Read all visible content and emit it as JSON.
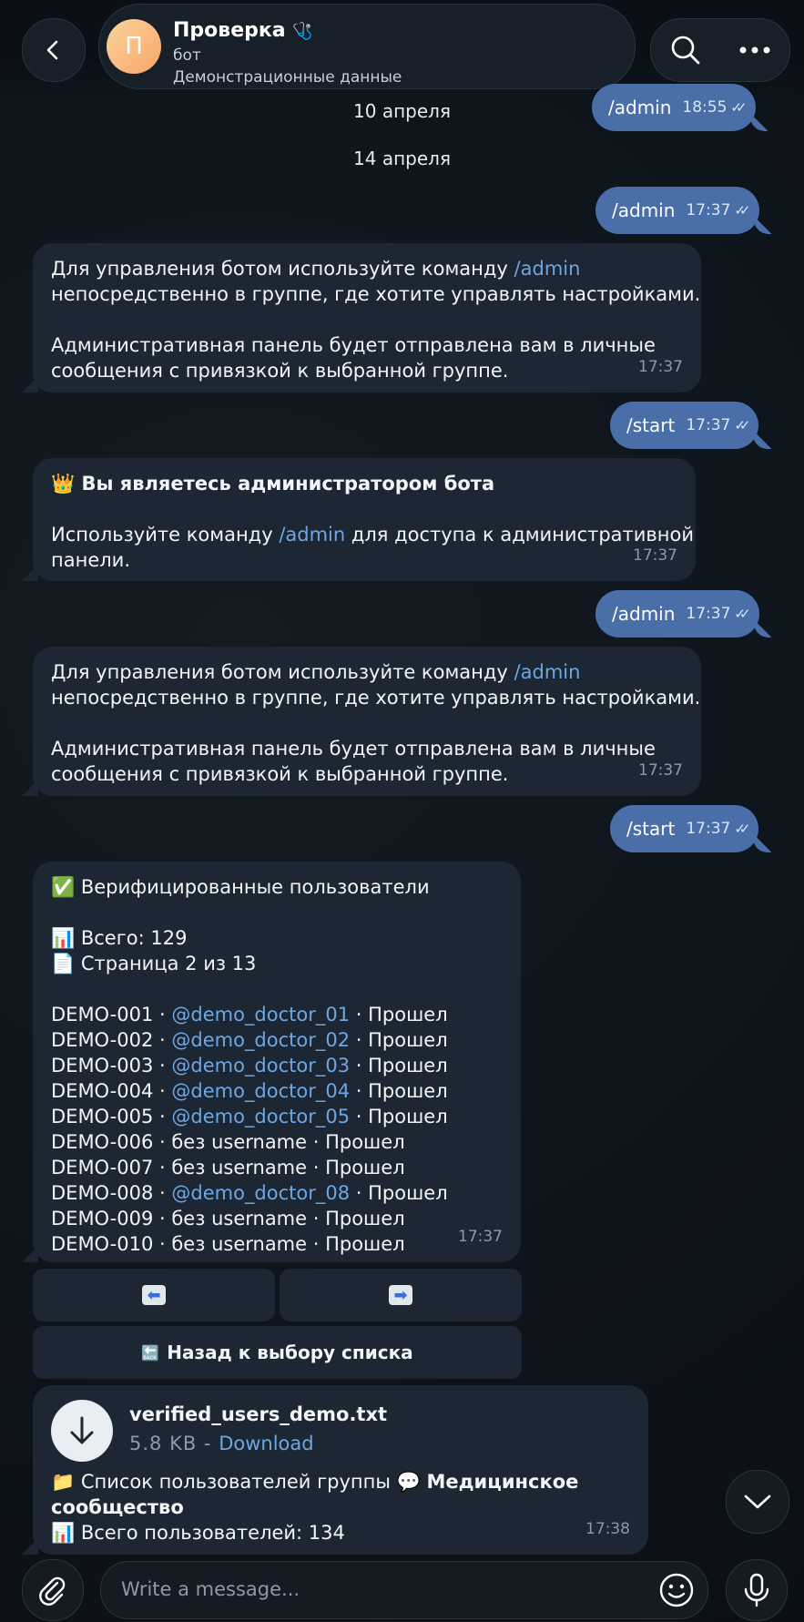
{
  "header": {
    "avatar_letter": "П",
    "title": "Проверка",
    "title_emoji": "🩺",
    "subtitle": "бот",
    "subtitle2": "Демонстрационные данные"
  },
  "dates": [
    "10 апреля",
    "14 апреля"
  ],
  "messages": {
    "m1": {
      "text": "/admin",
      "time": "18:55"
    },
    "m2": {
      "text": "/admin",
      "time": "17:37"
    },
    "m3": {
      "line1": "Для управления ботом используйте команду ",
      "link": "/admin",
      "line2": "непосредственно в группе, где хотите управлять настройками.",
      "line3": "Административная панель будет отправлена вам в личные",
      "line4": "сообщения с привязкой к выбранной группе.",
      "time": "17:37"
    },
    "m4": {
      "text": "/start",
      "time": "17:37"
    },
    "m5": {
      "emoji": "👑",
      "title": "Вы являетесь администратором бота",
      "line1": "Используйте команду ",
      "link": "/admin",
      "line1b": " для доступа к административной",
      "line2": "панели.",
      "time": "17:37"
    },
    "m6": {
      "text": "/admin",
      "time": "17:37"
    },
    "m7": {
      "line1": "Для управления ботом используйте команду ",
      "link": "/admin",
      "line2": "непосредственно в группе, где хотите управлять настройками.",
      "line3": "Административная панель будет отправлена вам в личные",
      "line4": "сообщения с привязкой к выбранной группе.",
      "time": "17:37"
    },
    "m8": {
      "text": "/start",
      "time": "17:37"
    },
    "m9": {
      "title_emoji": "✅",
      "title": "Верифицированные пользователи",
      "stats_emoji": "📊",
      "total": "Всего: 129",
      "page_emoji": "📄",
      "page": "Страница 2 из 13",
      "time": "17:37",
      "rows": [
        {
          "id": "DEMO-001 · ",
          "user": "@demo_doctor_01",
          "status": " · Прошел"
        },
        {
          "id": "DEMO-002 · ",
          "user": "@demo_doctor_02",
          "status": " · Прошел"
        },
        {
          "id": "DEMO-003 · ",
          "user": "@demo_doctor_03",
          "status": " · Прошел"
        },
        {
          "id": "DEMO-004 · ",
          "user": "@demo_doctor_04",
          "status": " · Прошел"
        },
        {
          "id": "DEMO-005 · ",
          "user": "@demo_doctor_05",
          "status": " · Прошел"
        },
        {
          "id": "DEMO-006 · без username · Прошел",
          "user": "",
          "status": ""
        },
        {
          "id": "DEMO-007 · без username · Прошел",
          "user": "",
          "status": ""
        },
        {
          "id": "DEMO-008 · ",
          "user": "@demo_doctor_08",
          "status": " · Прошел"
        },
        {
          "id": "DEMO-009 · без username · Прошел",
          "user": "",
          "status": ""
        },
        {
          "id": "DEMO-010 · без username · Прошел",
          "user": "",
          "status": ""
        }
      ]
    },
    "keyboard": {
      "prev": "⬅",
      "next": "➡",
      "back_icon": "🔙",
      "back_label": "Назад к выбору списка"
    },
    "file": {
      "name": "verified_users_demo.txt",
      "size": "5.8 KB - ",
      "download": "Download",
      "line1_emoji": "📁",
      "line1": "Список пользователей группы ",
      "group_emoji": "💬",
      "group": "Медицинское",
      "group2": "сообщество",
      "total_emoji": "📊",
      "total": "Всего пользователей: 134",
      "time": "17:38"
    }
  },
  "composer": {
    "placeholder": "Write a message..."
  }
}
